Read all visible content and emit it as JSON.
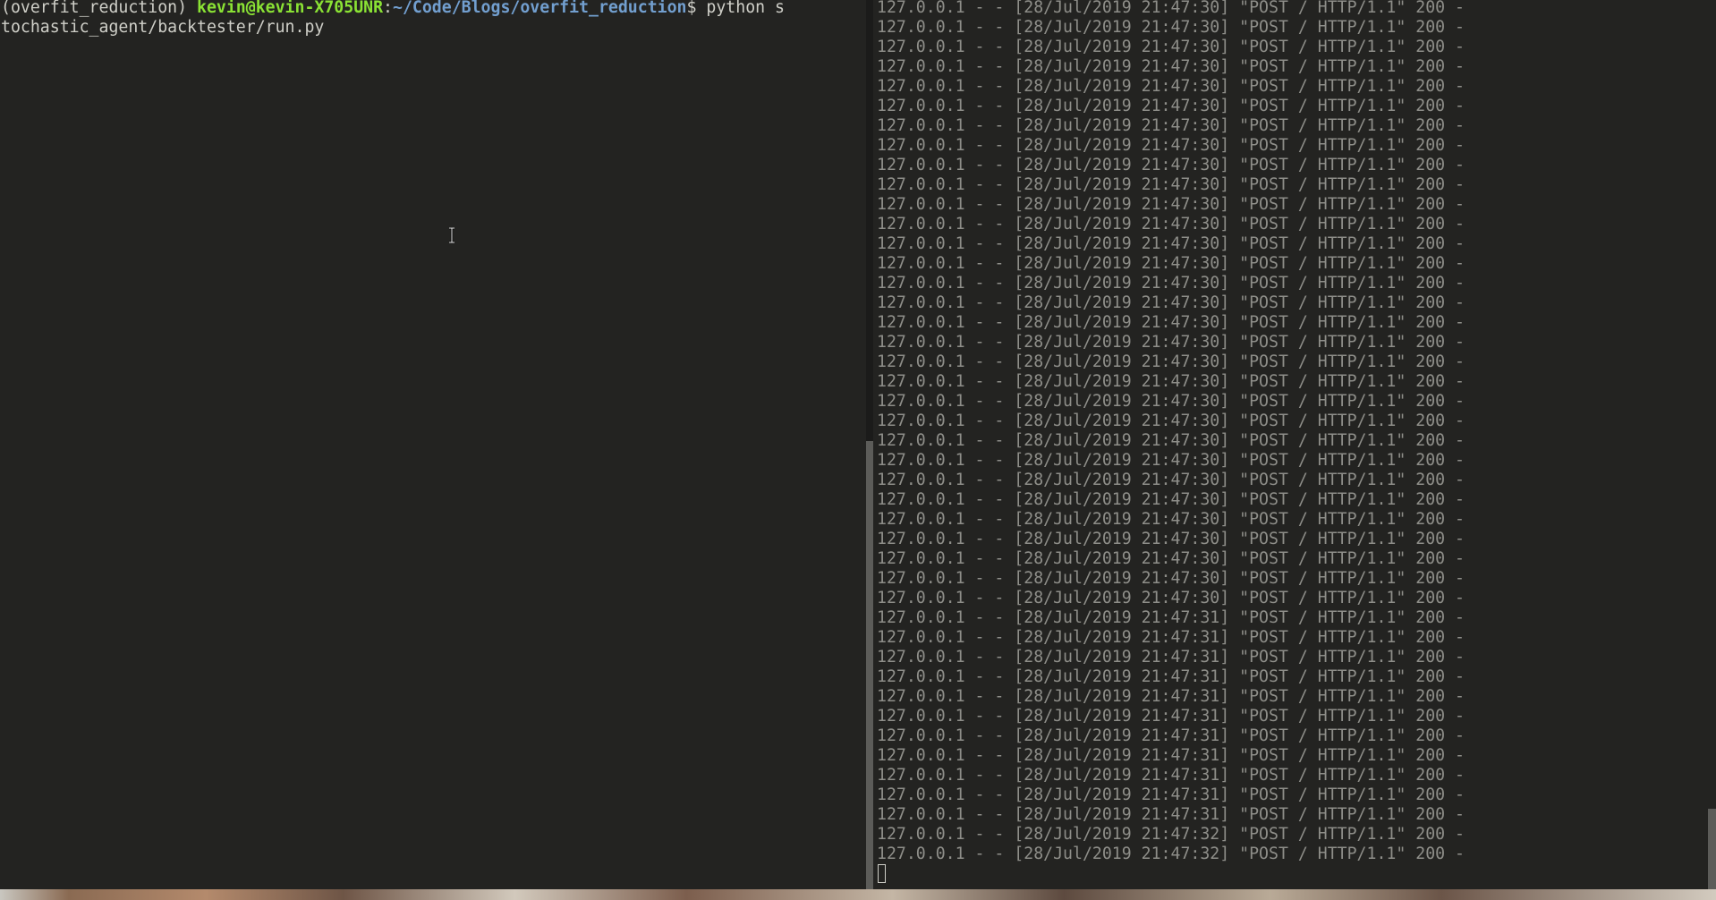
{
  "left_terminal": {
    "prompt_env": "(overfit_reduction) ",
    "prompt_user_host": "kevin@kevin-X705UNR",
    "prompt_sep": ":",
    "prompt_path": "~/Code/Blogs/overfit_reduction",
    "prompt_symbol": "$ ",
    "command_line1": "python s",
    "command_line2": "tochastic_agent/backtester/run.py"
  },
  "right_terminal": {
    "log_lines": [
      "127.0.0.1 - - [28/Jul/2019 21:47:30] \"POST / HTTP/1.1\" 200 -",
      "127.0.0.1 - - [28/Jul/2019 21:47:30] \"POST / HTTP/1.1\" 200 -",
      "127.0.0.1 - - [28/Jul/2019 21:47:30] \"POST / HTTP/1.1\" 200 -",
      "127.0.0.1 - - [28/Jul/2019 21:47:30] \"POST / HTTP/1.1\" 200 -",
      "127.0.0.1 - - [28/Jul/2019 21:47:30] \"POST / HTTP/1.1\" 200 -",
      "127.0.0.1 - - [28/Jul/2019 21:47:30] \"POST / HTTP/1.1\" 200 -",
      "127.0.0.1 - - [28/Jul/2019 21:47:30] \"POST / HTTP/1.1\" 200 -",
      "127.0.0.1 - - [28/Jul/2019 21:47:30] \"POST / HTTP/1.1\" 200 -",
      "127.0.0.1 - - [28/Jul/2019 21:47:30] \"POST / HTTP/1.1\" 200 -",
      "127.0.0.1 - - [28/Jul/2019 21:47:30] \"POST / HTTP/1.1\" 200 -",
      "127.0.0.1 - - [28/Jul/2019 21:47:30] \"POST / HTTP/1.1\" 200 -",
      "127.0.0.1 - - [28/Jul/2019 21:47:30] \"POST / HTTP/1.1\" 200 -",
      "127.0.0.1 - - [28/Jul/2019 21:47:30] \"POST / HTTP/1.1\" 200 -",
      "127.0.0.1 - - [28/Jul/2019 21:47:30] \"POST / HTTP/1.1\" 200 -",
      "127.0.0.1 - - [28/Jul/2019 21:47:30] \"POST / HTTP/1.1\" 200 -",
      "127.0.0.1 - - [28/Jul/2019 21:47:30] \"POST / HTTP/1.1\" 200 -",
      "127.0.0.1 - - [28/Jul/2019 21:47:30] \"POST / HTTP/1.1\" 200 -",
      "127.0.0.1 - - [28/Jul/2019 21:47:30] \"POST / HTTP/1.1\" 200 -",
      "127.0.0.1 - - [28/Jul/2019 21:47:30] \"POST / HTTP/1.1\" 200 -",
      "127.0.0.1 - - [28/Jul/2019 21:47:30] \"POST / HTTP/1.1\" 200 -",
      "127.0.0.1 - - [28/Jul/2019 21:47:30] \"POST / HTTP/1.1\" 200 -",
      "127.0.0.1 - - [28/Jul/2019 21:47:30] \"POST / HTTP/1.1\" 200 -",
      "127.0.0.1 - - [28/Jul/2019 21:47:30] \"POST / HTTP/1.1\" 200 -",
      "127.0.0.1 - - [28/Jul/2019 21:47:30] \"POST / HTTP/1.1\" 200 -",
      "127.0.0.1 - - [28/Jul/2019 21:47:30] \"POST / HTTP/1.1\" 200 -",
      "127.0.0.1 - - [28/Jul/2019 21:47:30] \"POST / HTTP/1.1\" 200 -",
      "127.0.0.1 - - [28/Jul/2019 21:47:30] \"POST / HTTP/1.1\" 200 -",
      "127.0.0.1 - - [28/Jul/2019 21:47:30] \"POST / HTTP/1.1\" 200 -",
      "127.0.0.1 - - [28/Jul/2019 21:47:30] \"POST / HTTP/1.1\" 200 -",
      "127.0.0.1 - - [28/Jul/2019 21:47:30] \"POST / HTTP/1.1\" 200 -",
      "127.0.0.1 - - [28/Jul/2019 21:47:30] \"POST / HTTP/1.1\" 200 -",
      "127.0.0.1 - - [28/Jul/2019 21:47:31] \"POST / HTTP/1.1\" 200 -",
      "127.0.0.1 - - [28/Jul/2019 21:47:31] \"POST / HTTP/1.1\" 200 -",
      "127.0.0.1 - - [28/Jul/2019 21:47:31] \"POST / HTTP/1.1\" 200 -",
      "127.0.0.1 - - [28/Jul/2019 21:47:31] \"POST / HTTP/1.1\" 200 -",
      "127.0.0.1 - - [28/Jul/2019 21:47:31] \"POST / HTTP/1.1\" 200 -",
      "127.0.0.1 - - [28/Jul/2019 21:47:31] \"POST / HTTP/1.1\" 200 -",
      "127.0.0.1 - - [28/Jul/2019 21:47:31] \"POST / HTTP/1.1\" 200 -",
      "127.0.0.1 - - [28/Jul/2019 21:47:31] \"POST / HTTP/1.1\" 200 -",
      "127.0.0.1 - - [28/Jul/2019 21:47:31] \"POST / HTTP/1.1\" 200 -",
      "127.0.0.1 - - [28/Jul/2019 21:47:31] \"POST / HTTP/1.1\" 200 -",
      "127.0.0.1 - - [28/Jul/2019 21:47:31] \"POST / HTTP/1.1\" 200 -",
      "127.0.0.1 - - [28/Jul/2019 21:47:32] \"POST / HTTP/1.1\" 200 -",
      "127.0.0.1 - - [28/Jul/2019 21:47:32] \"POST / HTTP/1.1\" 200 -"
    ]
  },
  "icons": {
    "mouse_cursor": "text-ibeam-cursor-icon"
  },
  "colors": {
    "background": "#232321",
    "text": "#cfcfc8",
    "log_text": "#8e8e89",
    "prompt_user": "#8ae234",
    "prompt_path": "#729fcf",
    "scrollbar_thumb": "#5c5c59"
  }
}
